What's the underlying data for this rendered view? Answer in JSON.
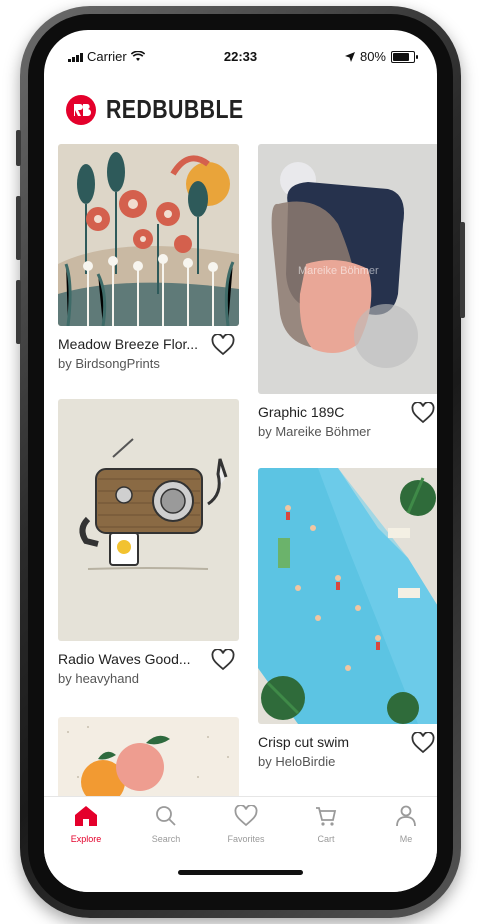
{
  "status_bar": {
    "carrier": "Carrier",
    "time": "22:33",
    "battery": "80%"
  },
  "header": {
    "brand": "REDBUBBLE"
  },
  "products": [
    {
      "title": "Meadow Breeze Flor...",
      "artist": "by BirdsongPrints"
    },
    {
      "title": "Graphic 189C",
      "artist": "by Mareike Böhmer",
      "watermark": "Mareike Böhmer"
    },
    {
      "title": "Radio Waves Good...",
      "artist": "by heavyhand"
    },
    {
      "title": "Crisp cut swim",
      "artist": "by HeloBirdie"
    }
  ],
  "tabs": [
    {
      "label": "Explore",
      "icon": "home-icon",
      "active": true
    },
    {
      "label": "Search",
      "icon": "search-icon"
    },
    {
      "label": "Favorites",
      "icon": "heart-icon"
    },
    {
      "label": "Cart",
      "icon": "cart-icon"
    },
    {
      "label": "Me",
      "icon": "person-icon"
    }
  ],
  "colors": {
    "brand": "#e4002b",
    "inactive_tab": "#9a9a9a"
  }
}
